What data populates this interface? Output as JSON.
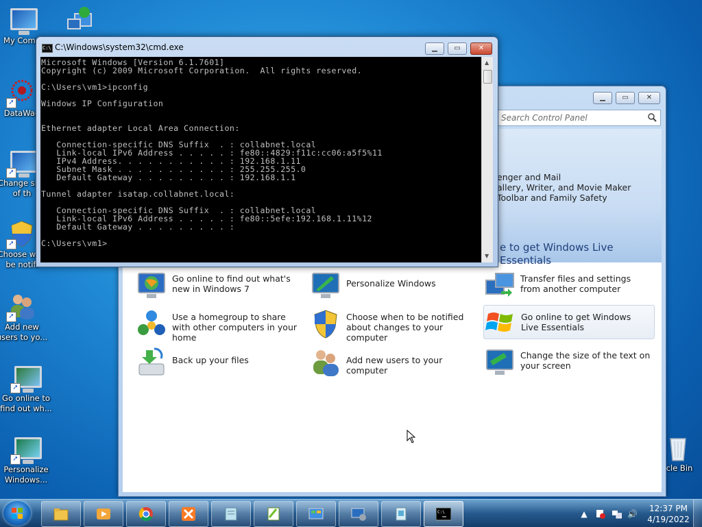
{
  "desktop": {
    "icons": [
      {
        "label": "My Comp",
        "name": "computer"
      },
      {
        "label": "DataWag",
        "name": "datawag"
      },
      {
        "label": "Change size of th",
        "name": "change-text-size"
      },
      {
        "label": "Choose w to be notifi",
        "name": "uac-notify"
      },
      {
        "label": "Add new users to yo...",
        "name": "add-users"
      },
      {
        "label": "Go online to find out wh...",
        "name": "whats-new"
      },
      {
        "label": "Personalize Windows...",
        "name": "personalize"
      },
      {
        "label": "cle Bin",
        "name": "recycle-bin"
      }
    ]
  },
  "cmd": {
    "title": "C:\\Windows\\system32\\cmd.exe",
    "lines": "Microsoft Windows [Version 6.1.7601]\nCopyright (c) 2009 Microsoft Corporation.  All rights reserved.\n\nC:\\Users\\vm1>ipconfig\n\nWindows IP Configuration\n\n\nEthernet adapter Local Area Connection:\n\n   Connection-specific DNS Suffix  . : collabnet.local\n   Link-local IPv6 Address . . . . . : fe80::4829:f11c:cc06:a5f5%11\n   IPv4 Address. . . . . . . . . . . : 192.168.1.11\n   Subnet Mask . . . . . . . . . . . : 255.255.255.0\n   Default Gateway . . . . . . . . . : 192.168.1.1\n\nTunnel adapter isatap.collabnet.local:\n\n   Connection-specific DNS Suffix  . : collabnet.local\n   Link-local IPv6 Address . . . . . : fe80::5efe:192.168.1.11%12\n   Default Gateway . . . . . . . . . :\n\nC:\\Users\\vm1>"
  },
  "control_panel": {
    "search_placeholder": "Search Control Panel",
    "hero_lines": [
      "enger and Mail",
      "allery, Writer, and Movie Maker",
      "Toolbar and Family Safety"
    ],
    "hero_link": "e to get Windows Live Essentials",
    "tasks": [
      {
        "label": "Go online to find out what's new in Windows 7",
        "icon": "monitor-globe-icon"
      },
      {
        "label": "Personalize Windows",
        "icon": "monitor-brush-icon"
      },
      {
        "label": "Transfer files and settings from another computer",
        "icon": "transfer-icon"
      },
      {
        "label": "Use a homegroup to share with other computers in your home",
        "icon": "homegroup-icon"
      },
      {
        "label": "Choose when to be notified about changes to your computer",
        "icon": "shield-icon"
      },
      {
        "label": "Go online to get Windows Live Essentials",
        "icon": "windows-flag-icon"
      },
      {
        "label": "Back up your files",
        "icon": "backup-icon"
      },
      {
        "label": "Add new users to your computer",
        "icon": "users-icon"
      },
      {
        "label": "Change the size of the text on your screen",
        "icon": "monitor-text-icon"
      }
    ]
  },
  "taskbar": {
    "items": [
      "windows-explorer",
      "media-player",
      "chrome",
      "xampp",
      "notepad-plus",
      "editor",
      "control-panel",
      "remote-desktop",
      "file-manager",
      "cmd"
    ],
    "time": "12:37 PM",
    "date": "4/19/2022"
  },
  "colors": {
    "desktop": "#1e86d3",
    "console_bg": "#000000",
    "console_fg": "#c0c0c0"
  }
}
